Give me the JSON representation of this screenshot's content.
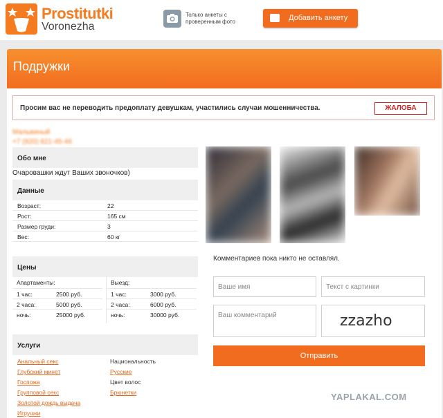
{
  "header": {
    "logo_title": "Prostitutki",
    "logo_subtitle": "Voronezha",
    "verified_text": "Только анкеты с проверенным фото",
    "add_button_label": "Добавить анкету"
  },
  "banner": {
    "title": "Подружки"
  },
  "warning": {
    "text": "Просим вас не переводить предоплату девушкам, участились случаи мошенничества.",
    "complain_label": "ЖАЛОБА"
  },
  "profile": {
    "name": "Мальвиный",
    "phone": "+7 (920) 821-45-46"
  },
  "about": {
    "heading": "Обо мне",
    "text": "Очаровашки ждут Ваших звоночков)"
  },
  "data_section": {
    "heading": "Данные",
    "rows": [
      {
        "label": "Возраст:",
        "value": "22"
      },
      {
        "label": "Рост:",
        "value": "165 см"
      },
      {
        "label": "Размер груди:",
        "value": "3"
      },
      {
        "label": "Вес:",
        "value": "60 кг"
      }
    ]
  },
  "prices": {
    "heading": "Цены",
    "apartments": {
      "title": "Апартаменты:",
      "rows": [
        {
          "label": "1 час:",
          "value": "2500 руб."
        },
        {
          "label": "2 часа:",
          "value": "5000 руб."
        },
        {
          "label": "ночь:",
          "value": "25000 руб."
        }
      ]
    },
    "outcall": {
      "title": "Выезд:",
      "rows": [
        {
          "label": "1 час:",
          "value": "3000 руб."
        },
        {
          "label": "2 часа:",
          "value": "6000 руб."
        },
        {
          "label": "ночь:",
          "value": "30000 руб."
        }
      ]
    }
  },
  "services": {
    "heading": "Услуги",
    "links": [
      "Анальный секс",
      "Глубокий минет",
      "Госпожа",
      "Групповой секс",
      "Золотой дождь выдача",
      "Игрушки"
    ],
    "nationality_label": "Национальность",
    "nationality_value": "Русские",
    "hair_label": "Цвет волос",
    "hair_value": "Брюнетки"
  },
  "comments": {
    "empty_text": "Комментариев пока никто не оставлял.",
    "name_placeholder": "Ваше имя",
    "captcha_placeholder": "Текст с картинки",
    "comment_placeholder": "Ваш комментарий",
    "captcha_value": "zzazho",
    "submit_label": "Отправить"
  },
  "watermark": "YAPLAKAL.COM",
  "colors": {
    "accent": "#f26c1f",
    "link": "#e2671a",
    "warning_border": "#c22222"
  }
}
